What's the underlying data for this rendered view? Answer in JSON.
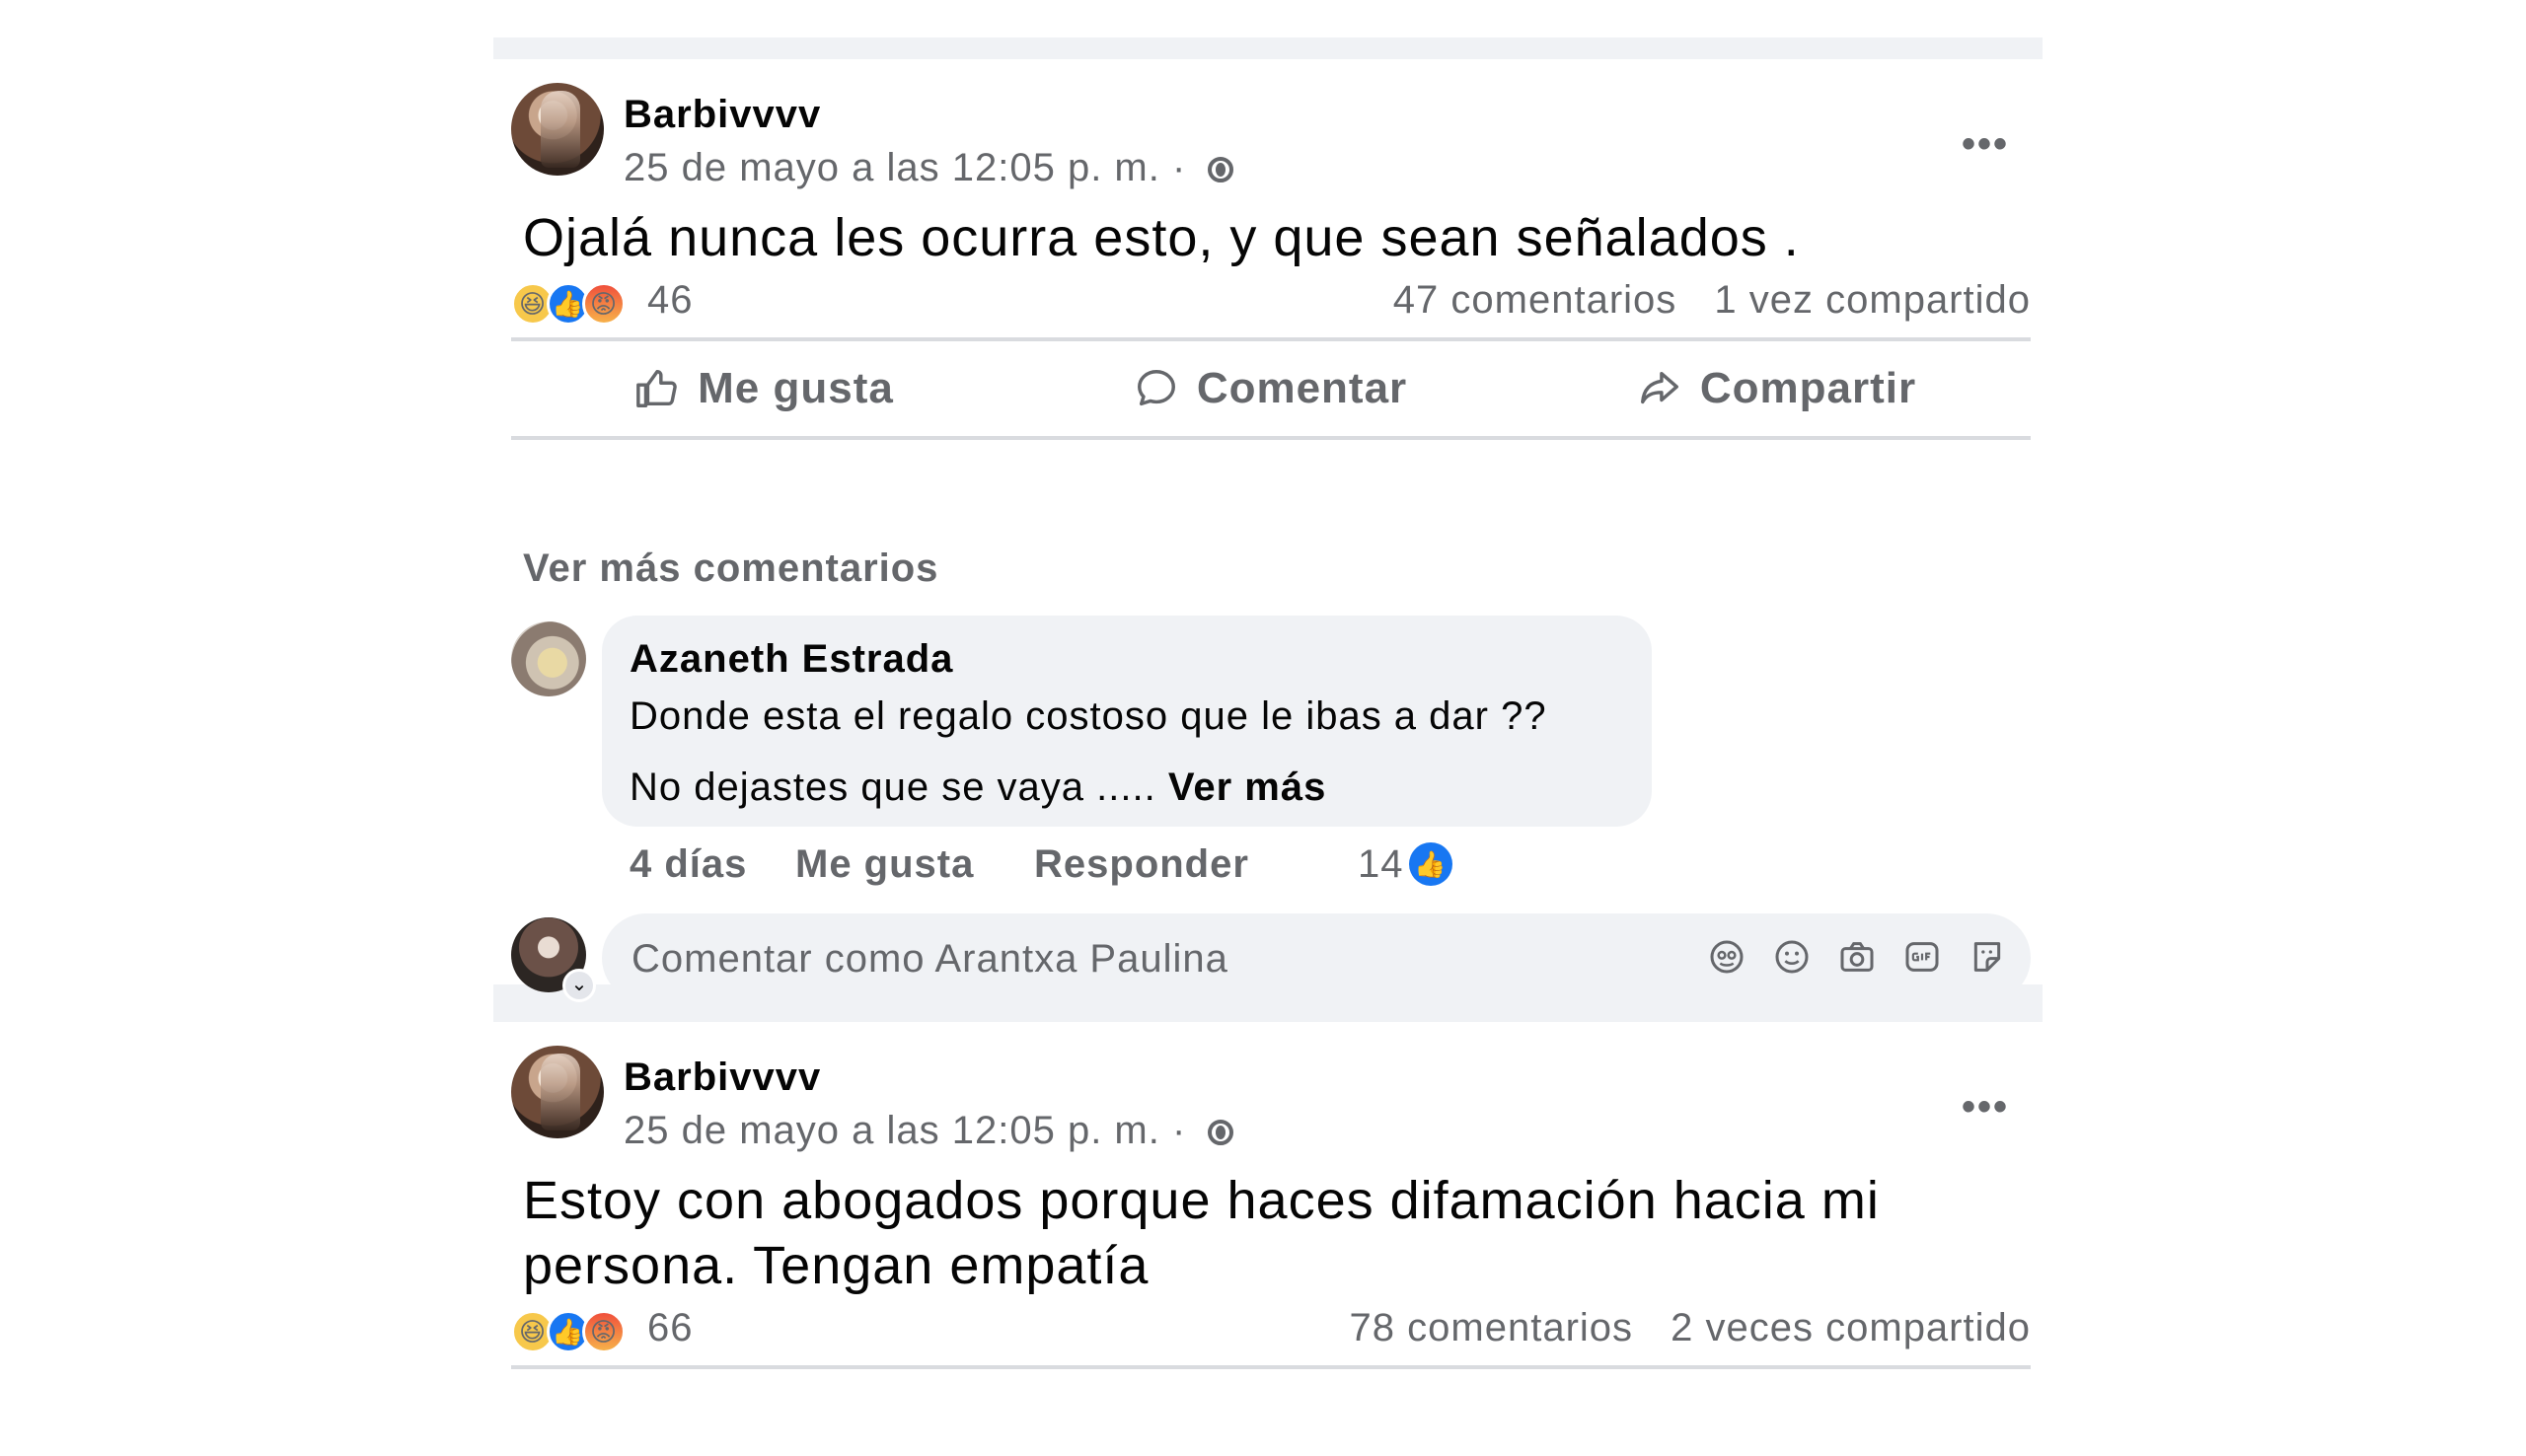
{
  "posts": [
    {
      "author": "Barbivvvv",
      "timestamp": "25 de mayo a las 12:05 p. m. ·",
      "privacy_icon": "globe-icon",
      "more_label": "•••",
      "text": "Ojalá nunca les ocurra esto, y que sean señalados .",
      "reactions": [
        "haha",
        "like",
        "angry"
      ],
      "reaction_count": "46",
      "comments_count": "47 comentarios",
      "shares_count": "1 vez compartido"
    },
    {
      "author": "Barbivvvv",
      "timestamp": "25 de mayo a las 12:05 p. m. ·",
      "privacy_icon": "globe-icon",
      "more_label": "•••",
      "text": "Estoy con abogados porque haces difamación hacia mi persona. Tengan empatía",
      "reactions": [
        "haha",
        "like",
        "angry"
      ],
      "reaction_count": "66",
      "comments_count": "78 comentarios",
      "shares_count": "2 veces compartido"
    }
  ],
  "actions": {
    "like": "Me gusta",
    "comment": "Comentar",
    "share": "Compartir"
  },
  "comments_section": {
    "see_more": "Ver más comentarios",
    "comment": {
      "author": "Azaneth Estrada",
      "line1": "Donde esta el regalo costoso que le ibas a dar ??",
      "line2": "No dejastes que se vaya .....",
      "see_more_link": "Ver más",
      "time": "4 días",
      "like_label": "Me gusta",
      "reply_label": "Responder",
      "like_count": "14"
    },
    "composer": {
      "placeholder": "Comentar como Arantxa Paulina",
      "tools": [
        "avatar-sticker-icon",
        "emoji-icon",
        "camera-icon",
        "gif-icon",
        "sticker-icon"
      ]
    }
  },
  "colors": {
    "accent": "#1877f2",
    "secondary_text": "#65676b",
    "bubble": "#f0f2f5"
  }
}
